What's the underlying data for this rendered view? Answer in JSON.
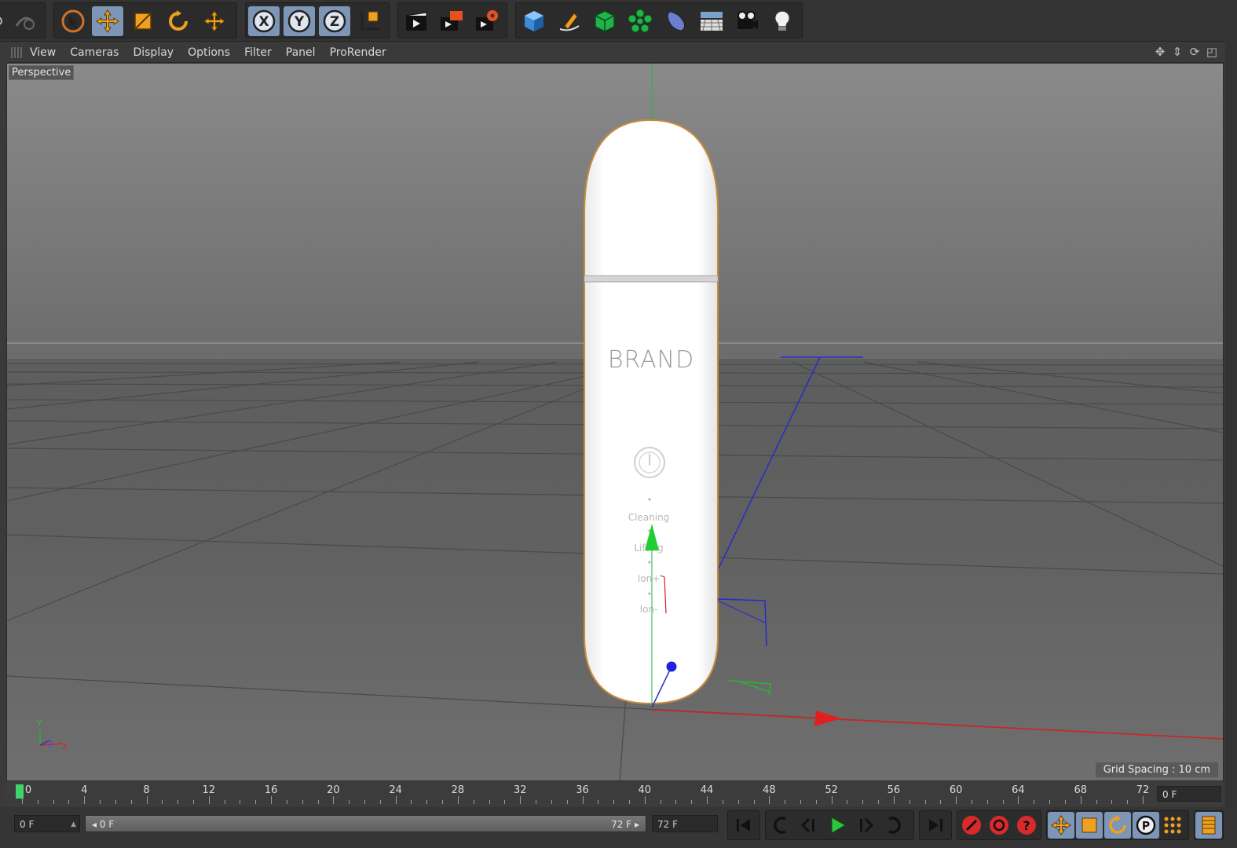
{
  "viewport_menu": {
    "items": [
      "View",
      "Cameras",
      "Display",
      "Options",
      "Filter",
      "Panel",
      "ProRender"
    ]
  },
  "viewport": {
    "camera_label": "Perspective",
    "grid_spacing": "Grid Spacing : 10 cm",
    "axis_labels": {
      "y": "Y",
      "z": "Z",
      "x": "X"
    }
  },
  "model": {
    "brand_text": "BRAND",
    "mode_labels": [
      "Cleaning",
      "Lifting",
      "Ion+",
      "Ion-"
    ]
  },
  "timeline": {
    "ticks": [
      "0",
      "4",
      "8",
      "12",
      "16",
      "20",
      "24",
      "28",
      "32",
      "36",
      "40",
      "44",
      "48",
      "52",
      "56",
      "60",
      "64",
      "68",
      "72"
    ],
    "current_frame_field": "0 F"
  },
  "bottom_bar": {
    "start_field": "0 F",
    "range_start": "0 F",
    "range_end": "72 F",
    "end_field": "72 F"
  },
  "icons": {
    "toolbar": [
      "undo-icon",
      "redo-icon",
      "select-icon",
      "move-icon",
      "scale-icon",
      "rotate-icon",
      "live-move-icon",
      "x-axis-lock-icon",
      "y-axis-lock-icon",
      "z-axis-lock-icon",
      "coordinate-system-icon",
      "render-view-icon",
      "render-picture-viewer-icon",
      "edit-render-settings-icon",
      "cube-primitive-icon",
      "pen-spline-icon",
      "subdivision-surface-icon",
      "cloner-icon",
      "deformer-icon",
      "floor-icon",
      "camera-icon",
      "light-icon"
    ]
  },
  "colors": {
    "accent_active": "#7d95b6",
    "axis_x": "#e02020",
    "axis_y": "#22c02a",
    "axis_z": "#2020e0",
    "playhead": "#3fd36b",
    "object_outline": "#c88a3a"
  }
}
